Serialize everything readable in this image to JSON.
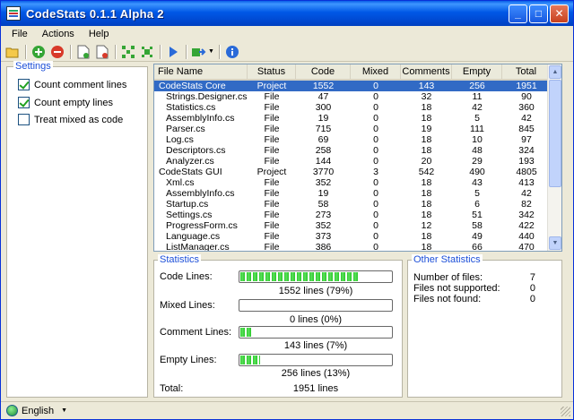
{
  "window": {
    "title": "CodeStats 0.1.1 Alpha 2"
  },
  "menu": {
    "file": "File",
    "actions": "Actions",
    "help": "Help"
  },
  "toolbar": {
    "icons": [
      "open-folder-icon",
      "add-icon",
      "remove-icon",
      "new-project-icon",
      "remove-project-icon",
      "expand-all-icon",
      "collapse-all-icon",
      "run-icon",
      "export-icon",
      "info-icon"
    ]
  },
  "settings": {
    "legend": "Settings",
    "options": [
      {
        "label": "Count comment lines",
        "checked": true
      },
      {
        "label": "Count empty lines",
        "checked": true
      },
      {
        "label": "Treat mixed as code",
        "checked": false
      }
    ]
  },
  "table": {
    "headers": [
      "File Name",
      "Status",
      "Code",
      "Mixed",
      "Comments",
      "Empty",
      "Total"
    ],
    "rows": [
      [
        "CodeStats Core",
        "Project",
        "1552",
        "0",
        "143",
        "256",
        "1951"
      ],
      [
        "Strings.Designer.cs",
        "File",
        "47",
        "0",
        "32",
        "11",
        "90"
      ],
      [
        "Statistics.cs",
        "File",
        "300",
        "0",
        "18",
        "42",
        "360"
      ],
      [
        "AssemblyInfo.cs",
        "File",
        "19",
        "0",
        "18",
        "5",
        "42"
      ],
      [
        "Parser.cs",
        "File",
        "715",
        "0",
        "19",
        "111",
        "845"
      ],
      [
        "Log.cs",
        "File",
        "69",
        "0",
        "18",
        "10",
        "97"
      ],
      [
        "Descriptors.cs",
        "File",
        "258",
        "0",
        "18",
        "48",
        "324"
      ],
      [
        "Analyzer.cs",
        "File",
        "144",
        "0",
        "20",
        "29",
        "193"
      ],
      [
        "CodeStats GUI",
        "Project",
        "3770",
        "3",
        "542",
        "490",
        "4805"
      ],
      [
        "Xml.cs",
        "File",
        "352",
        "0",
        "18",
        "43",
        "413"
      ],
      [
        "AssemblyInfo.cs",
        "File",
        "19",
        "0",
        "18",
        "5",
        "42"
      ],
      [
        "Startup.cs",
        "File",
        "58",
        "0",
        "18",
        "6",
        "82"
      ],
      [
        "Settings.cs",
        "File",
        "273",
        "0",
        "18",
        "51",
        "342"
      ],
      [
        "ProgressForm.cs",
        "File",
        "352",
        "0",
        "12",
        "58",
        "422"
      ],
      [
        "Language.cs",
        "File",
        "373",
        "0",
        "18",
        "49",
        "440"
      ],
      [
        "ListManager.cs",
        "File",
        "386",
        "0",
        "18",
        "66",
        "470"
      ]
    ],
    "selected_row": 0
  },
  "statistics": {
    "legend": "Statistics",
    "code": {
      "label": "Code Lines:",
      "value": "1552 lines (79%)",
      "fraction": 0.79
    },
    "mixed": {
      "label": "Mixed Lines:",
      "value": "0 lines (0%)",
      "fraction": 0
    },
    "comment": {
      "label": "Comment Lines:",
      "value": "143 lines (7%)",
      "fraction": 0.07
    },
    "empty": {
      "label": "Empty Lines:",
      "value": "256 lines (13%)",
      "fraction": 0.13
    },
    "total": {
      "label": "Total:",
      "value": "1951 lines"
    }
  },
  "other": {
    "legend": "Other Statistics",
    "items": [
      {
        "label": "Number of files:",
        "value": "7"
      },
      {
        "label": "Files not supported:",
        "value": "0"
      },
      {
        "label": "Files not found:",
        "value": "0"
      }
    ]
  },
  "status": {
    "language": "English"
  }
}
